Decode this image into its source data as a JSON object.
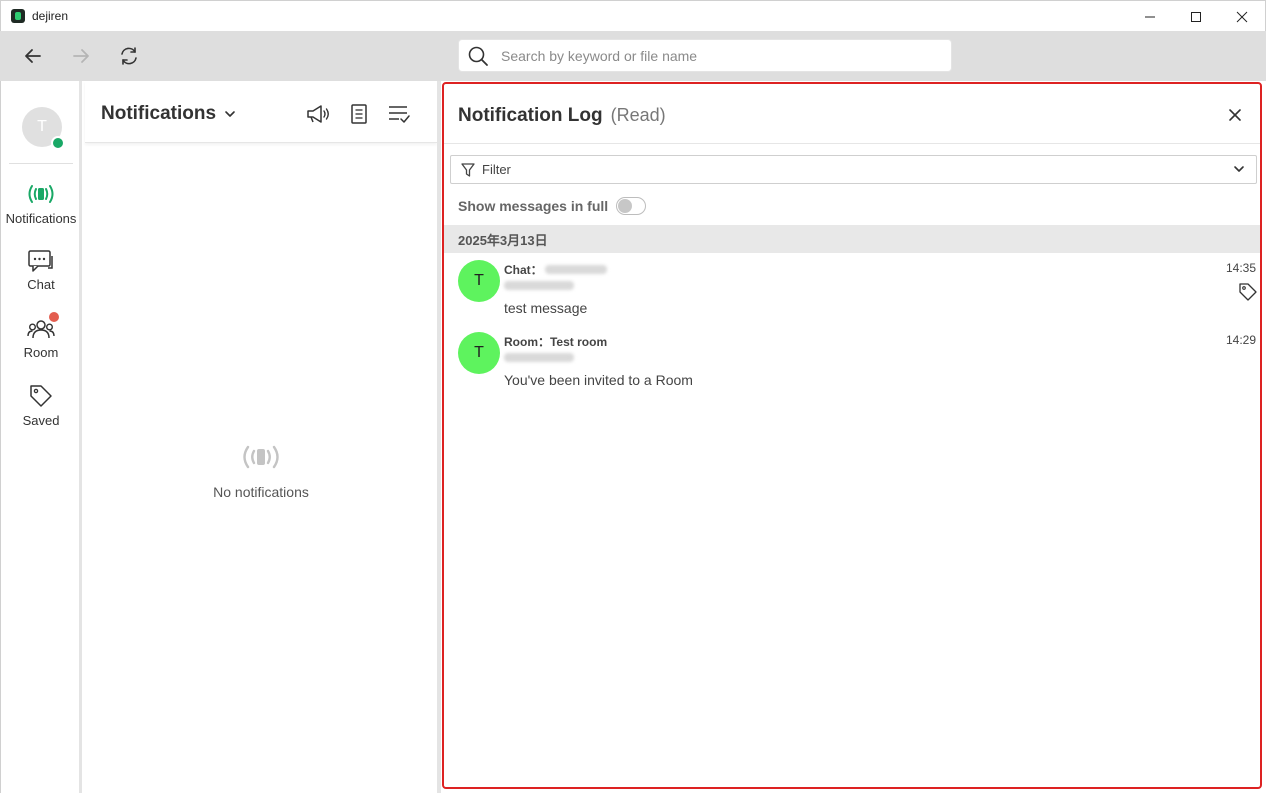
{
  "titlebar": {
    "app_name": "dejiren",
    "controls": [
      "minimize-icon",
      "maximize-icon",
      "close-icon"
    ]
  },
  "toolbar": {
    "back_icon": "arrow-left-icon",
    "forward_icon": "arrow-right-icon",
    "refresh_icon": "refresh-icon",
    "search": {
      "placeholder": "Search by keyword or file name",
      "value": ""
    }
  },
  "rail": {
    "avatar_initial": "T",
    "items": [
      {
        "label": "Notifications",
        "icon": "notifications-icon",
        "active": true
      },
      {
        "label": "Chat",
        "icon": "chat-icon"
      },
      {
        "label": "Room",
        "icon": "room-icon",
        "badge": true
      },
      {
        "label": "Saved",
        "icon": "tag-icon"
      }
    ]
  },
  "middle": {
    "title": "Notifications",
    "icons": [
      "megaphone-icon",
      "document-icon",
      "checklist-icon"
    ],
    "empty_text": "No notifications"
  },
  "log": {
    "title": "Notification Log",
    "subtitle": "(Read)",
    "filter_label": "Filter",
    "toggle_label": "Show messages in full",
    "toggle_on": false,
    "date": "2025年3月13日",
    "messages": [
      {
        "initial": "T",
        "source": "Chat：",
        "body": "test message",
        "time": "14:35",
        "tagged": true
      },
      {
        "initial": "T",
        "source": "Room：Test room",
        "body": "You've been invited to a Room",
        "time": "14:29",
        "tagged": false
      }
    ]
  },
  "colors": {
    "accent_green": "#19a866",
    "avatar_green": "#5ef35e",
    "highlight_red": "#dd2222",
    "badge_red": "#e35d4f"
  }
}
